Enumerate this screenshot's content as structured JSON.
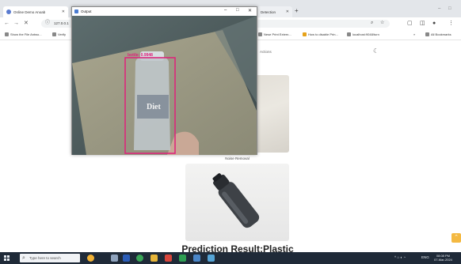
{
  "browser": {
    "tabs": [
      {
        "label": "Online Demo Anoab"
      },
      {
        "label": "Detection"
      }
    ],
    "new_tab": "+",
    "url": "127.0.0.1",
    "window_controls": [
      "–",
      "□"
    ],
    "bookmarks": [
      {
        "label": "Show the File Antwo..."
      },
      {
        "label": "Verify"
      },
      {
        "label": "Nese Print Extern..."
      },
      {
        "label": "How to disable Prin..."
      },
      {
        "label": "localhost:9048/turn"
      },
      {
        "label": "»"
      },
      {
        "label": "All Bookmarks"
      }
    ]
  },
  "page": {
    "nav_text": "Actions",
    "noise_removal_caption": "Noise Removal",
    "prediction_result": "Prediction Result:Plastic"
  },
  "output_window": {
    "title": "Output",
    "minimize": "–",
    "maximize": "□",
    "close": "✕",
    "detection_label": "bottle: 0.9948"
  },
  "taskbar": {
    "search_placeholder": "Type here to search",
    "tray_lang": "ENG",
    "time": "08:08 PM",
    "date": "07-Mar-2024"
  },
  "colors": {
    "detection_box": "#e0207a",
    "taskbar": "#1f2a38",
    "scroll_button": "#f4b942"
  }
}
